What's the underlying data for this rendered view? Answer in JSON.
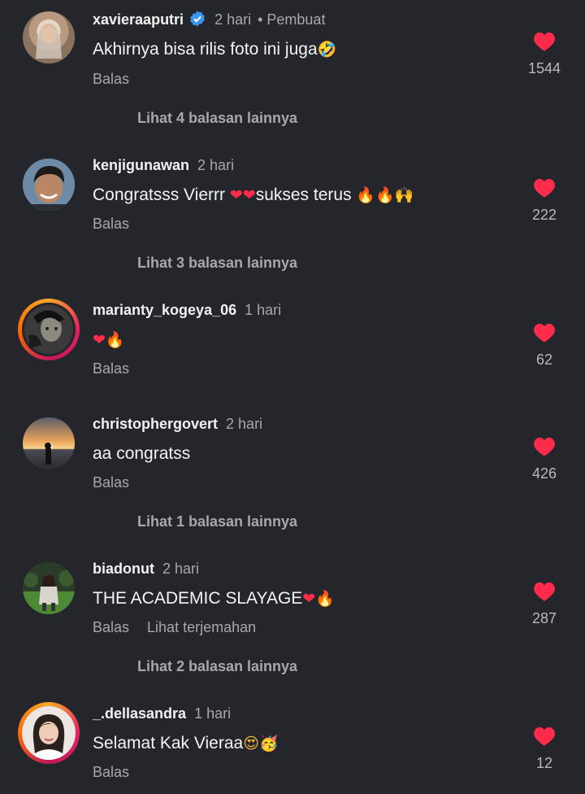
{
  "comments": [
    {
      "username": "xavieraaputri",
      "time": "2 hari",
      "badge": "• Pembuat",
      "verified": true,
      "text": "Akhirnya bisa rilis foto ini juga",
      "emoji": "🤣",
      "reply_label": "Balas",
      "likes": "1544",
      "view_replies": "Lihat 4 balasan lainnya"
    },
    {
      "username": "kenjigunawan",
      "time": "2 hari",
      "text_a": "Congratsss Vierrr",
      "emoji_a": "❤❤",
      "text_b": "sukses terus",
      "emoji_b": "🔥🔥",
      "emoji_c": "🙌",
      "reply_label": "Balas",
      "likes": "222",
      "view_replies": "Lihat 3 balasan lainnya"
    },
    {
      "username": "marianty_kogeya_06",
      "time": "1 hari",
      "emoji_a": "❤",
      "emoji_b": "🔥",
      "reply_label": "Balas",
      "likes": "62"
    },
    {
      "username": "christophergovert",
      "time": "2 hari",
      "text": "aa congratss",
      "reply_label": "Balas",
      "likes": "426",
      "view_replies": "Lihat 1 balasan lainnya"
    },
    {
      "username": "biadonut",
      "time": "2 hari",
      "text": "THE ACADEMIC SLAYAGE",
      "emoji_a": "❤",
      "emoji_b": "🔥",
      "reply_label": "Balas",
      "translate_label": "Lihat terjemahan",
      "likes": "287",
      "view_replies": "Lihat 2 balasan lainnya"
    },
    {
      "username": "_.dellasandra",
      "time": "1 hari",
      "text": "Selamat Kak Vieraa",
      "emoji_a": "😍",
      "emoji_b": "🥳",
      "reply_label": "Balas",
      "likes": "12"
    }
  ],
  "icons": {
    "like": "heart-icon",
    "verified": "verified-badge-icon"
  },
  "colors": {
    "background": "#25262b",
    "like": "#ff2b4a",
    "secondary_text": "#a7a8ad",
    "verified": "#3897f0"
  }
}
